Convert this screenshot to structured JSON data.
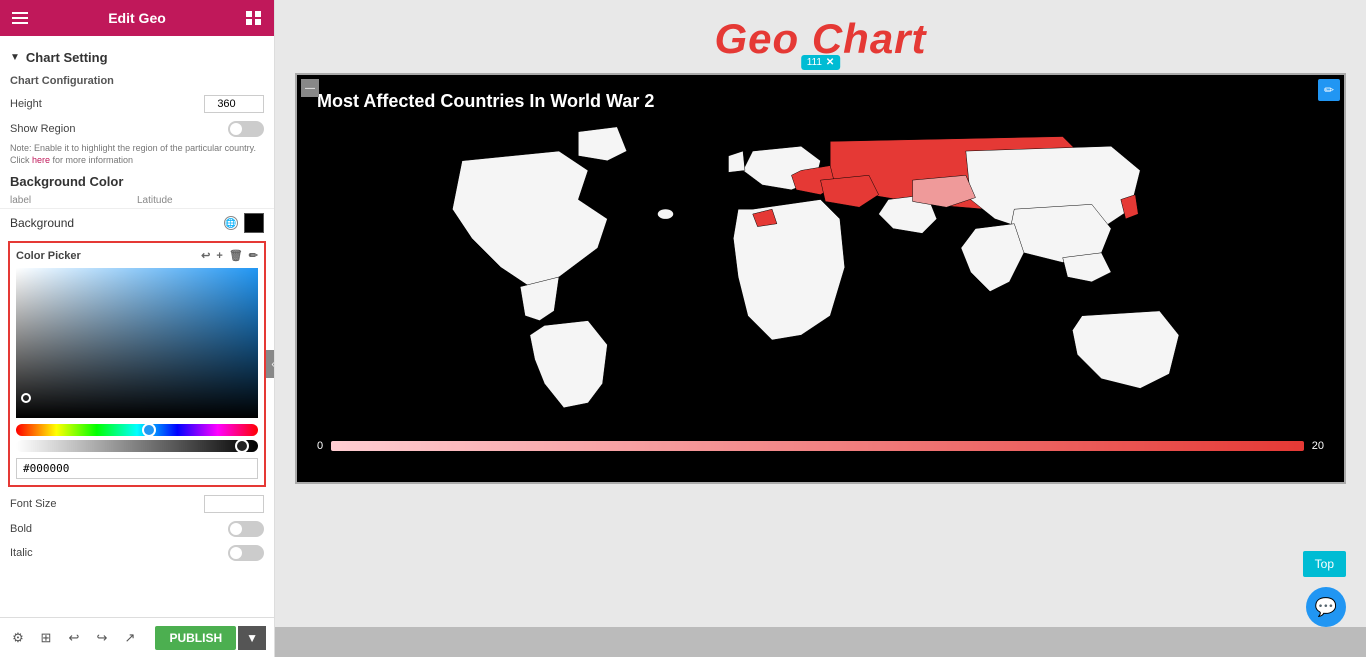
{
  "sidebar": {
    "header": {
      "title": "Edit Geo",
      "hamburger_label": "menu",
      "grid_label": "grid"
    },
    "chart_setting": {
      "label": "Chart Setting",
      "chart_config_label": "Chart Configuration",
      "height_label": "Height",
      "height_value": "360",
      "show_region_label": "Show Region",
      "note_text": "Note: Enable it to highlight the region of the particular country. Click ",
      "note_link": "here",
      "note_text2": " for more information",
      "bg_color_label": "Background Color",
      "table_col_label": "label",
      "table_col_latitude": "Latitude",
      "background_label": "Background",
      "color_picker_label": "Color Picker",
      "hex_value": "#000000",
      "font_size_label": "Font Size",
      "bold_label": "Bold",
      "italic_label": "Italic"
    }
  },
  "footer": {
    "publish_label": "PUBLISH",
    "more_label": "▼"
  },
  "main": {
    "geo_chart_title": "Geo Chart",
    "chart_title": "Most Affected Countries In World War 2",
    "bubble_value": "111",
    "scale_min": "0",
    "scale_max": "20",
    "top_button": "Top"
  }
}
